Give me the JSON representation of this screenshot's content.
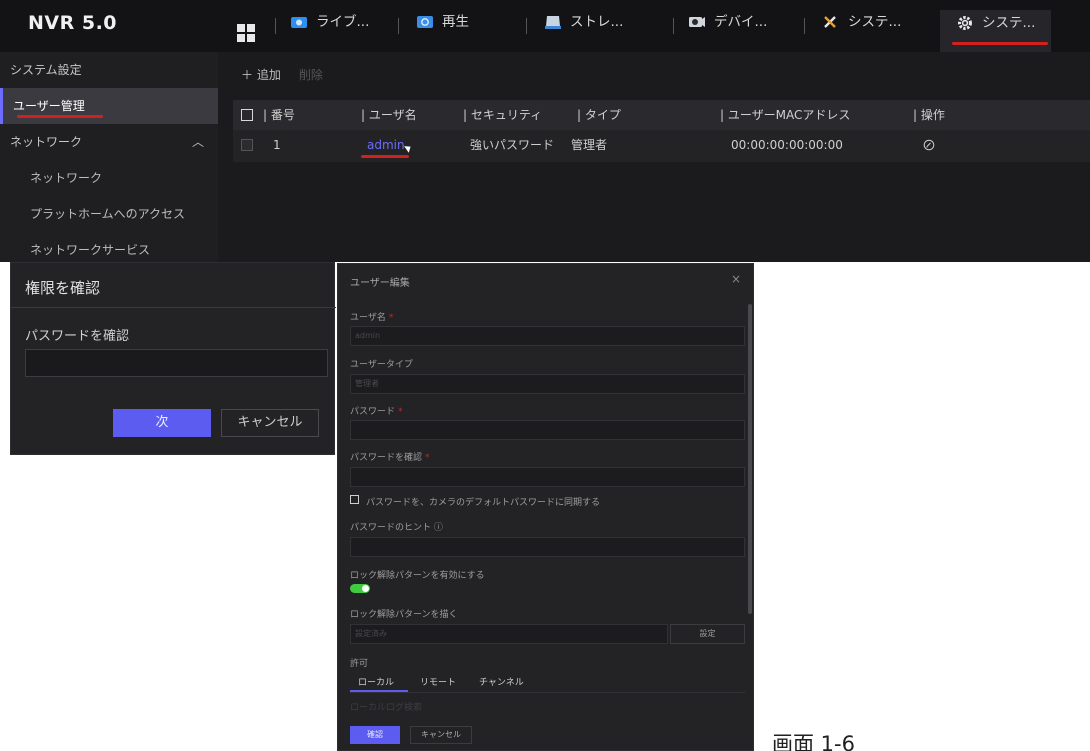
{
  "app": {
    "logo": "NVR 5.0"
  },
  "tabs": [
    {
      "label": "ライブ...",
      "icon": "camera-icon"
    },
    {
      "label": "再生",
      "icon": "playback-icon"
    },
    {
      "label": "ストレ...",
      "icon": "storage-icon"
    },
    {
      "label": "デバイ...",
      "icon": "device-icon"
    },
    {
      "label": "システ...",
      "icon": "tools-icon"
    },
    {
      "label": "システ...",
      "icon": "gear-icon"
    }
  ],
  "sidebar": {
    "items": [
      {
        "label": "システム設定"
      },
      {
        "label": "ユーザー管理"
      },
      {
        "label": "ネットワーク"
      },
      {
        "label": "ネットワーク"
      },
      {
        "label": "プラットホームへのアクセス"
      },
      {
        "label": "ネットワークサービス"
      }
    ]
  },
  "toolbar": {
    "add": "＋ 追加",
    "delete": "削除"
  },
  "table": {
    "headers": [
      "番号",
      "ユーザ名",
      "セキュリティ",
      "タイプ",
      "ユーザーMACアドレス",
      "操作"
    ],
    "rows": [
      {
        "no": "1",
        "username": "admin",
        "security": "強いパスワード",
        "type": "管理者",
        "mac": "00:00:00:00:00:00",
        "action_icon": "edit-icon"
      }
    ]
  },
  "perm_dialog": {
    "title": "権限を確認",
    "label": "パスワードを確認",
    "next": "次",
    "cancel": "キャンセル"
  },
  "edit_dialog": {
    "title": "ユーザー編集",
    "close": "×",
    "username_label": "ユーザ名",
    "username_value": "admin",
    "usertype_label": "ユーザータイプ",
    "usertype_value": "管理者",
    "password_label": "パスワード",
    "confirm_label": "パスワードを確認",
    "sync_label": "パスワードを、カメラのデフォルトパスワードに同期する",
    "hint_label": "パスワードのヒント ⓘ",
    "unlock_enable_label": "ロック解除パターンを有効にする",
    "unlock_enabled": true,
    "unlock_draw_label": "ロック解除パターンを描く",
    "unlock_draw_value": "設定済み",
    "set_button": "設定",
    "permission_label": "許可",
    "permission_tabs": [
      "ローカル",
      "リモート",
      "チャンネル"
    ],
    "log_label": "ローカルログ検索",
    "confirm_button": "確認",
    "cancel_button": "キャンセル"
  },
  "page_ref": "画面 1-6"
}
